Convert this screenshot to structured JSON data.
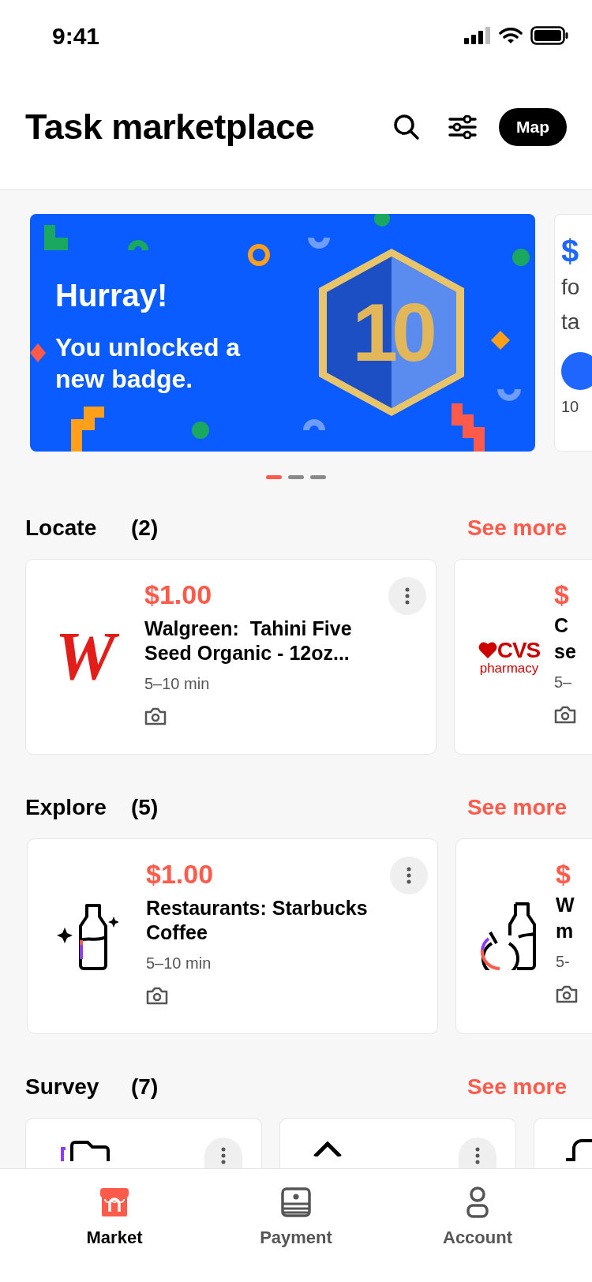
{
  "status_bar": {
    "time": "9:41"
  },
  "header": {
    "title": "Task marketplace",
    "map_button": "Map"
  },
  "carousel": {
    "slides": [
      {
        "kind": "badge",
        "title": "Hurray!",
        "message": "You unlocked a new badge.",
        "badge_label": "10"
      },
      {
        "kind": "peek",
        "lines": [
          "$",
          "fo",
          "ta"
        ],
        "footer": "10"
      }
    ],
    "dots": [
      {
        "selected": true
      },
      {
        "selected": false
      },
      {
        "selected": false
      }
    ]
  },
  "sections": [
    {
      "name": "Locate",
      "count": "(2)",
      "see_more": "See more",
      "cards": [
        {
          "kind": "full",
          "logo": {
            "kind": "walgreens",
            "text": "W"
          },
          "price": "$1.00",
          "title": "Walgreen:  Tahini Five Seed Organic - 12oz...",
          "duration": "5–10 min"
        },
        {
          "kind": "peek",
          "logo": {
            "kind": "cvs",
            "text": "CVS",
            "subtext": "pharmacy"
          },
          "price": "$",
          "title_lines": [
            "C",
            "se"
          ],
          "duration": "5–"
        }
      ]
    },
    {
      "name": "Explore",
      "count": "(5)",
      "see_more": "See more",
      "cards": [
        {
          "kind": "full",
          "logo": {
            "kind": "bottle_sparkle"
          },
          "price": "$1.00",
          "title": "Restaurants: Starbucks Coffee",
          "duration": "5–10 min"
        },
        {
          "kind": "peek",
          "logo": {
            "kind": "bottle_timer"
          },
          "price": "$",
          "title_lines": [
            "W",
            "m"
          ],
          "duration": "5-"
        }
      ]
    },
    {
      "name": "Survey",
      "count": "(7)",
      "see_more": "See more",
      "cards": [
        {
          "kind": "stub",
          "logo": {
            "kind": "folder"
          }
        },
        {
          "kind": "stub",
          "logo": {
            "kind": "chevron"
          }
        },
        {
          "kind": "stub",
          "logo": {
            "kind": "hat"
          }
        }
      ]
    }
  ],
  "bottom_nav": [
    {
      "label": "Market",
      "selected": true
    },
    {
      "label": "Payment",
      "selected": false
    },
    {
      "label": "Account",
      "selected": false
    }
  ]
}
